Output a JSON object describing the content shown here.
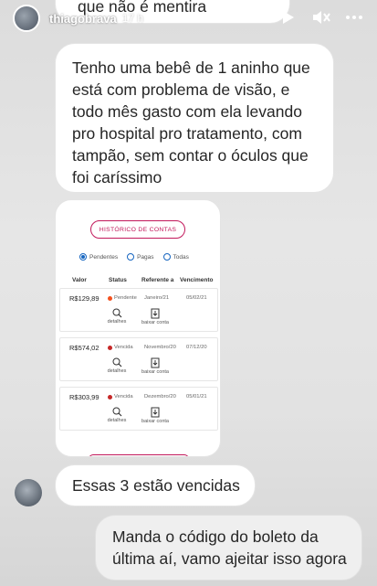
{
  "story": {
    "username": "thiagobrava",
    "time": "17 h"
  },
  "messages": {
    "top_partial": "que não é mentira",
    "long": "Tenho uma bebê de 1 aninho que está com problema de visão, e todo mês gasto com ela levando pro hospital pro tratamento, com tampão, sem contar o óculos que foi caríssimo",
    "mid": "Essas 3 estão vencidas",
    "outgoing": "Manda o código do boleto da última aí, vamo ajeitar isso agora"
  },
  "card": {
    "title": "HISTÓRICO DE CONTAS",
    "filters": [
      "Pendentes",
      "Pagas",
      "Todas"
    ],
    "selected_filter": "Pendentes",
    "columns": [
      "Valor",
      "Status",
      "Referente a",
      "Vencimento"
    ],
    "rows": [
      {
        "valor": "R$129,89",
        "status": "Pendente",
        "referente": "Janeiro/21",
        "vencimento": "05/02/21",
        "status_color": "#f4511e"
      },
      {
        "valor": "R$574,02",
        "status": "Vencida",
        "referente": "Novembro/20",
        "vencimento": "07/12/20",
        "status_color": "#c62828"
      },
      {
        "valor": "R$303,99",
        "status": "Vencida",
        "referente": "Dezembro/20",
        "vencimento": "05/01/21",
        "status_color": "#c62828"
      }
    ],
    "action_details": "detalhes",
    "action_download": "baixar conta"
  },
  "colors": {
    "accent": "#c2185b",
    "radio": "#1565c0"
  },
  "icons": [
    "play-icon",
    "mute-icon",
    "more-icon",
    "search-icon",
    "download-icon"
  ]
}
